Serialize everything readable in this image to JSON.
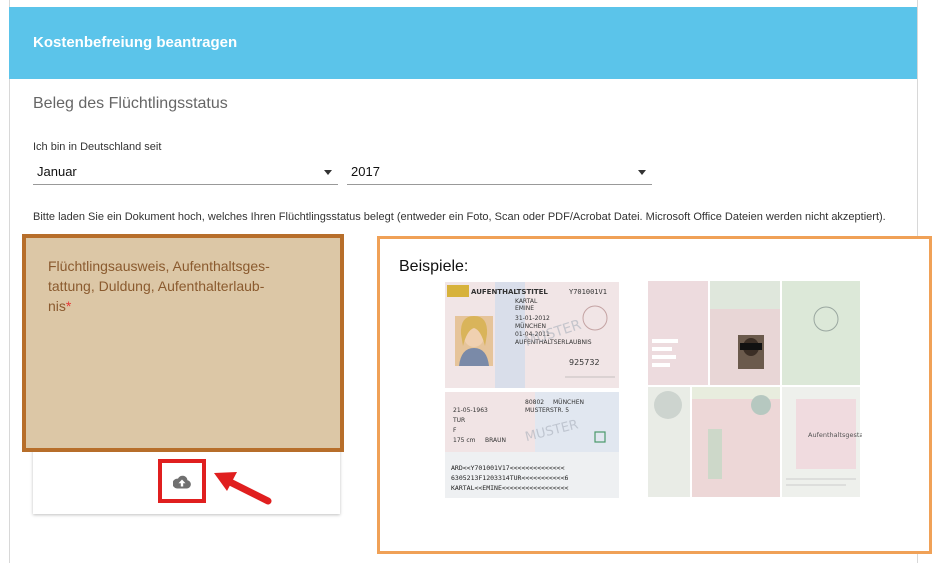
{
  "header": {
    "title": "Kostenbefreiung beantragen"
  },
  "section": {
    "title": "Beleg des Flüchtlingsstatus"
  },
  "since": {
    "label": "Ich bin in Deutschland seit",
    "month": "Januar",
    "year": "2017"
  },
  "instructions": "Bitte laden Sie ein Dokument hoch, welches Ihren Flüchtlingsstatus belegt (entweder ein Foto, Scan oder PDF/Acrobat Datei. Microsoft Office Dateien werden nicht akzeptiert).",
  "document": {
    "label": "Flüchtlingsausweis, Aufenthaltsges-tattung, Duldung, Aufenthalterlaub-nis",
    "label_lines": [
      "Flüchtlingsausweis, Aufenthaltsges-",
      "tattung, Duldung, Aufenthalterlaub-",
      "nis"
    ],
    "required_mark": "*",
    "upload_icon": "cloud-upload-icon"
  },
  "examples": {
    "label": "Beispiele:",
    "card": {
      "title": "AUFENTHALTSTITEL",
      "number": "Y701001V1",
      "surname": "KARTAL",
      "given": "EMINE",
      "date1": "31-01-2012",
      "city": "MÜNCHEN",
      "date2": "01-04-2011",
      "doc_type": "AUFENTHALTSERLAUBNIS",
      "pin": "925732",
      "watermark": "MUSTER",
      "back_birth": "21-05-1963",
      "back_nat": "TUR",
      "back_sex": "F",
      "back_height": "175 cm",
      "back_eyes": "BRAUN",
      "back_zip": "80802",
      "back_city": "MÜNCHEN",
      "back_street": "MUSTERSTR. 5",
      "mrz": [
        "ARD<<Y701001V17<<<<<<<<<<<<<<",
        "6305213F1203314TUR<<<<<<<<<<<6",
        "KARTAL<<EMINE<<<<<<<<<<<<<<<<<"
      ]
    },
    "booklet": {
      "right_text": "Aufenthaltsgestattung"
    }
  },
  "colors": {
    "header": "#5bc4ea",
    "doc_bg": "#dcc7a6",
    "doc_border": "#b76e2a",
    "examples_border": "#f0a157",
    "highlight": "#e01f1f"
  }
}
